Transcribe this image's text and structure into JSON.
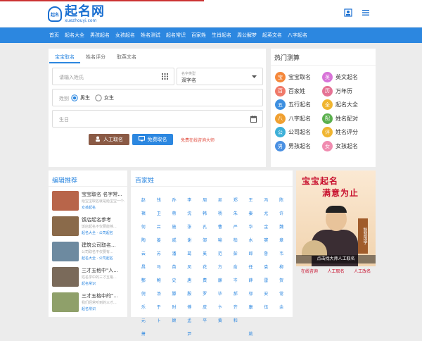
{
  "header": {
    "logo_badge": "起名",
    "logo_cn": "起名网",
    "logo_en": "xuezhouyi.com"
  },
  "nav": [
    "首页",
    "起名大全",
    "男孩起名",
    "女孩起名",
    "姓名测试",
    "起名常识",
    "百家姓",
    "生肖起名",
    "周公解梦",
    "起英文名",
    "八字起名"
  ],
  "form": {
    "tabs": [
      "宝宝取名",
      "姓名评分",
      "取英文名"
    ],
    "surname_placeholder": "请输入姓氏",
    "name_type_label": "名字类型",
    "name_type_value": "双字名",
    "gender_label": "姓别",
    "gender_male": "男生",
    "gender_female": "女生",
    "birthday_placeholder": "生日",
    "btn_manual": "人工取名",
    "btn_free": "免费取名",
    "consult": "免费在线咨询大师"
  },
  "hot": {
    "title": "热门测算",
    "items": [
      {
        "label": "宝宝取名",
        "color": "#f5883b",
        "glyph": "宝"
      },
      {
        "label": "英文起名",
        "color": "#d874d8",
        "glyph": "英"
      },
      {
        "label": "百家姓",
        "color": "#f07a6a",
        "glyph": "百"
      },
      {
        "label": "万年历",
        "color": "#e57395",
        "glyph": "历"
      },
      {
        "label": "五行起名",
        "color": "#3d8fe0",
        "glyph": "五"
      },
      {
        "label": "起名大全",
        "color": "#f0b530",
        "glyph": "全"
      },
      {
        "label": "八字起名",
        "color": "#f0a030",
        "glyph": "八"
      },
      {
        "label": "姓名配对",
        "color": "#5bb04e",
        "glyph": "配"
      },
      {
        "label": "公司起名",
        "color": "#3db0d8",
        "glyph": "公"
      },
      {
        "label": "姓名评分",
        "color": "#f0b530",
        "glyph": "评"
      },
      {
        "label": "男孩起名",
        "color": "#4a90e2",
        "glyph": "男"
      },
      {
        "label": "女孩起名",
        "color": "#f08cb0",
        "glyph": "女"
      }
    ]
  },
  "recommend": {
    "title": "编辑推荐",
    "items": [
      {
        "title": "宝宝取名 名字常...",
        "desc": "给宝宝取名就是给宝宝一个...",
        "tag": "女孩起名",
        "thumb": "#b8654a"
      },
      {
        "title": "饭店起名参考",
        "desc": "饭店起名不仅要能够...",
        "tag": "起名大全 · 公司起名",
        "thumb": "#8a6a4a"
      },
      {
        "title": "建筑公司取名...",
        "desc": "公司取名不仅要有...",
        "tag": "起名大全 · 公司起名",
        "thumb": "#6d8aa0"
      },
      {
        "title": "三才五格中\"人...",
        "desc": "姓名学中的三才五格...",
        "tag": "起名常识",
        "thumb": "#7a6a5a"
      },
      {
        "title": "三才五格中的\"...",
        "desc": "我们经常听到的三才...",
        "tag": "起名常识",
        "thumb": "#8fa06a"
      }
    ]
  },
  "surnames": {
    "title": "百家姓",
    "list": [
      "赵",
      "钱",
      "孙",
      "李",
      "周",
      "吴",
      "郑",
      "王",
      "冯",
      "陈",
      "褚",
      "卫",
      "蒋",
      "沈",
      "韩",
      "杨",
      "朱",
      "秦",
      "尤",
      "许",
      "何",
      "吕",
      "施",
      "张",
      "孔",
      "曹",
      "严",
      "华",
      "金",
      "魏",
      "陶",
      "姜",
      "戚",
      "谢",
      "邹",
      "喻",
      "柏",
      "水",
      "窦",
      "章",
      "云",
      "苏",
      "潘",
      "葛",
      "奚",
      "范",
      "彭",
      "郎",
      "鲁",
      "韦",
      "昌",
      "马",
      "苗",
      "凤",
      "花",
      "方",
      "俞",
      "任",
      "袁",
      "柳",
      "酆",
      "鲍",
      "史",
      "唐",
      "费",
      "廉",
      "岑",
      "薛",
      "雷",
      "贺",
      "倪",
      "汤",
      "滕",
      "殷",
      "罗",
      "毕",
      "郝",
      "邬",
      "安",
      "常",
      "乐",
      "于",
      "时",
      "傅",
      "皮",
      "卞",
      "齐",
      "康",
      "伍",
      "余",
      "元",
      "卜",
      "顾",
      "孟",
      "平",
      "黄",
      "和",
      "",
      "",
      "",
      "萧",
      "",
      "",
      "尹",
      "",
      "",
      "",
      "姚"
    ]
  },
  "ad": {
    "title1": "宝宝起名",
    "title2": "满意为止",
    "vertical": "智慧国学",
    "caption": "点击找大师人工取名",
    "links": [
      "在线咨询",
      "人工取名",
      "人工改名"
    ]
  }
}
